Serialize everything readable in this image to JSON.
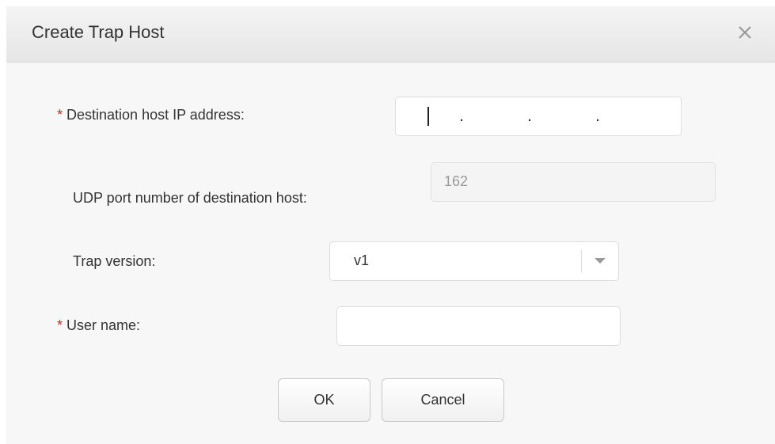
{
  "dialog": {
    "title": "Create Trap Host",
    "close_icon": "close-icon"
  },
  "form": {
    "required_marker": "*",
    "ip_label": "Destination host IP address:",
    "ip_separator": ".",
    "port_label": "UDP port number of destination host:",
    "port_value": "162",
    "trap_version_label": "Trap version:",
    "trap_version_value": "v1",
    "trap_version_arrow_icon": "chevron-down-icon",
    "username_label": "User name:",
    "username_value": ""
  },
  "buttons": {
    "ok": "OK",
    "cancel": "Cancel"
  }
}
